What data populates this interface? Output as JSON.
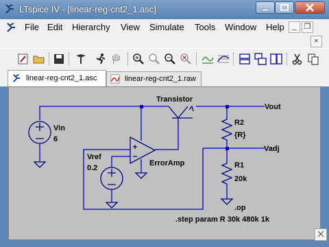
{
  "window": {
    "title": "LTspice IV - [linear-reg-cnt2_1.asc]"
  },
  "menu": [
    "File",
    "Edit",
    "Hierarchy",
    "View",
    "Simulate",
    "Tools",
    "Window",
    "Help"
  ],
  "tabs": [
    {
      "label": "linear-reg-cnt2_1.asc",
      "active": true
    },
    {
      "label": "linear-reg-cnt2_1.raw",
      "active": false
    }
  ],
  "schematic": {
    "components": {
      "vin_name": "Vin",
      "vin_value": "6",
      "vref_name": "Vref",
      "vref_value": "0.2",
      "transistor_label": "Transistor",
      "opamp_label": "ErrorAmp",
      "r2_name": "R2",
      "r2_value": "{R}",
      "r1_name": "R1",
      "r1_value": "20k"
    },
    "nets": {
      "vout": "Vout",
      "vadj": "Vadj"
    },
    "directives": {
      "op": ".op",
      "step": ".step param R 30k 480k 1k"
    }
  },
  "colors": {
    "wire": "#0000cc",
    "component": "#000080",
    "canvas": "#c0c0c0"
  }
}
